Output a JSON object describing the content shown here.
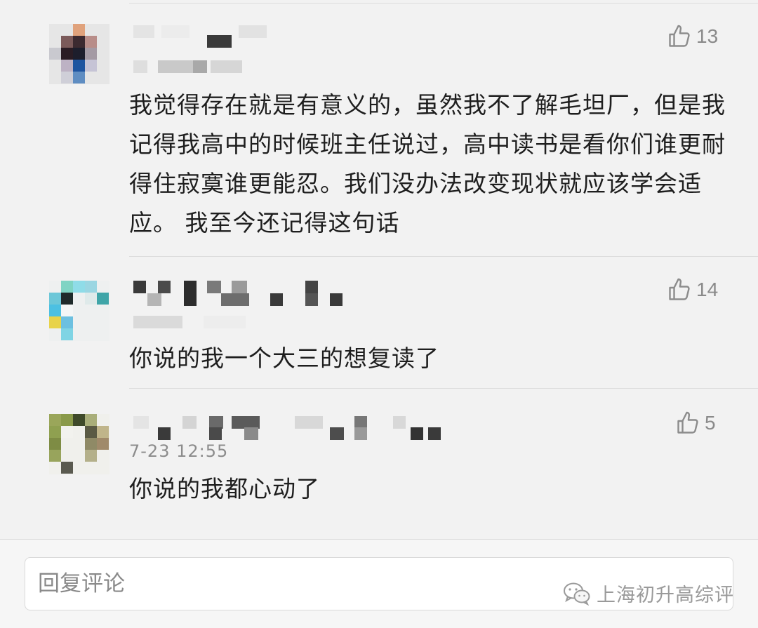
{
  "comments": [
    {
      "likes": "13",
      "time": "",
      "text": "我觉得存在就是有意义的，虽然我不了解毛坦厂，但是我记得我高中的时候班主任说过，高中读书是看你们谁更耐得住寂寞谁更能忍。我们没办法改变现状就应该学会适应。 我至今还记得这句话"
    },
    {
      "likes": "14",
      "time": "",
      "text": "你说的我一个大三的想复读了"
    },
    {
      "likes": "5",
      "time": "7-23 12:55",
      "text": "你说的我都心动了"
    }
  ],
  "reply": {
    "placeholder": "回复评论"
  },
  "watermark": {
    "text": "上海初升高综评"
  },
  "icons": {
    "like": "thumbs-up-icon",
    "watermark": "wechat-icon"
  },
  "colors": {
    "background": "#f2f2f2",
    "text": "#1e1e1e",
    "muted": "#8c8c8c"
  }
}
